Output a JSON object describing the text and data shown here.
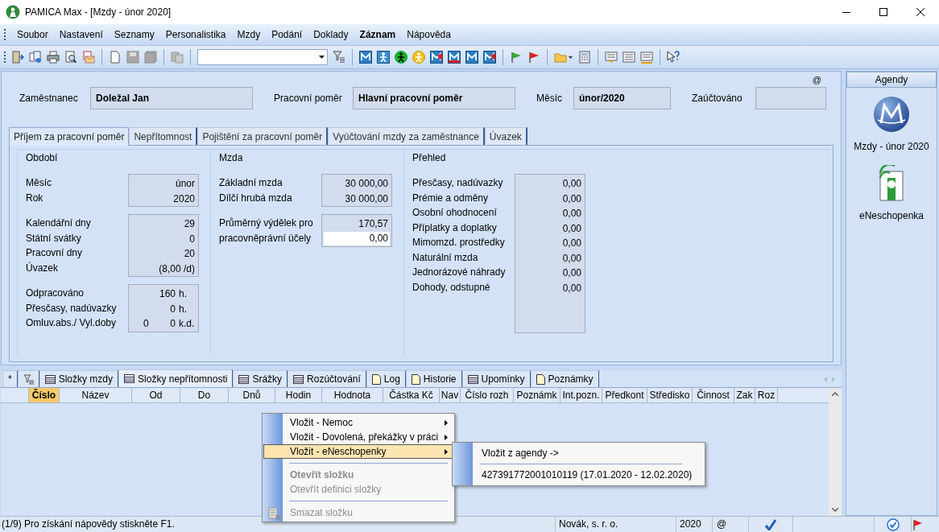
{
  "window": {
    "title": "PAMICA Max - [Mzdy - únor 2020]"
  },
  "menu": [
    {
      "label": "Soubor",
      "bold": false
    },
    {
      "label": "Nastavení",
      "bold": false
    },
    {
      "label": "Seznamy",
      "bold": false
    },
    {
      "label": "Personalistika",
      "bold": false
    },
    {
      "label": "Mzdy",
      "bold": false
    },
    {
      "label": "Podání",
      "bold": false
    },
    {
      "label": "Doklady",
      "bold": false
    },
    {
      "label": "Záznam",
      "bold": true
    },
    {
      "label": "Nápověda",
      "bold": false
    }
  ],
  "header": {
    "marker": "@",
    "fields": [
      {
        "label": "Zaměstnanec",
        "value": "Doležal Jan"
      },
      {
        "label": "Pracovní poměr",
        "value": "Hlavní pracovní poměr"
      },
      {
        "label": "Měsíc",
        "value": "únor/2020"
      },
      {
        "label": "Zaúčtováno"
      }
    ]
  },
  "tabs": [
    {
      "label": "Příjem za pracovní poměr",
      "selected": true
    },
    {
      "label": "Nepřítomnost",
      "selected": false
    },
    {
      "label": "Pojištění za pracovní poměr",
      "selected": false
    },
    {
      "label": "Vyúčtování mzdy za zaměstnance",
      "selected": false
    },
    {
      "label": "Úvazek",
      "selected": false
    }
  ],
  "groups": [
    {
      "title": "Období",
      "boxes": [
        {
          "rows": [
            {
              "label": "Měsíc",
              "values": [
                "únor"
              ]
            },
            {
              "label": "Rok",
              "values": [
                "2020"
              ]
            }
          ]
        },
        {
          "rows": [
            {
              "label": "Kalendářní dny",
              "values": [
                "29"
              ]
            },
            {
              "label": "Státní svátky",
              "values": [
                "0"
              ]
            },
            {
              "label": "Pracovní dny",
              "values": [
                "20"
              ]
            },
            {
              "label": "Úvazek",
              "values": [
                "(8,00 /d)"
              ]
            }
          ]
        },
        {
          "rows": [
            {
              "label": "Odpracováno",
              "values": [
                "160"
              ],
              "unit": "h."
            },
            {
              "label": "Přesčasy, nadúvazky",
              "values": [
                "0"
              ],
              "unit": "h."
            },
            {
              "label": "Omluv.abs./ Vyl.doby",
              "values": [
                "0",
                "0"
              ],
              "unit": "k.d."
            }
          ]
        }
      ]
    },
    {
      "title": "Mzda",
      "boxes": [
        {
          "rows": [
            {
              "label": "Základní mzda",
              "values": [
                "30 000,00"
              ]
            },
            {
              "label": "Dílčí hrubá mzda",
              "values": [
                "30 000,00"
              ]
            }
          ]
        },
        {
          "rows": [
            {
              "label": "Průměrný výdělek pro",
              "values": [
                "170,57"
              ]
            },
            {
              "label": "pracovněprávní účely",
              "values": [
                "0,00"
              ],
              "editable": true
            }
          ]
        }
      ]
    },
    {
      "title": "Přehled",
      "boxes": [
        {
          "tall": true,
          "rows": [
            {
              "label": "Přesčasy, nadúvazky",
              "values": [
                "0,00"
              ]
            },
            {
              "label": "Prémie a odměny",
              "values": [
                "0,00"
              ]
            },
            {
              "label": "Osobní ohodnocení",
              "values": [
                "0,00"
              ]
            },
            {
              "label": "Příplatky a doplatky",
              "values": [
                "0,00"
              ]
            },
            {
              "label": "Mimomzd. prostředky",
              "values": [
                "0,00"
              ]
            },
            {
              "label": "Naturální mzda",
              "values": [
                "0,00"
              ]
            },
            {
              "label": "Jednorázové náhrady",
              "values": [
                "0,00"
              ]
            },
            {
              "label": "Dohody, odstupné",
              "values": [
                "0,00"
              ]
            }
          ]
        }
      ]
    }
  ],
  "bottom_tabs": [
    {
      "kind": "text",
      "label": "*",
      "selected": false
    },
    {
      "kind": "filter",
      "selected": false
    },
    {
      "kind": "grid",
      "label": "Složky mzdy",
      "selected": false
    },
    {
      "kind": "grid",
      "label": "Složky nepřítomnosti",
      "selected": true
    },
    {
      "kind": "grid",
      "label": "Srážky",
      "selected": false
    },
    {
      "kind": "grid",
      "label": "Rozúčtování",
      "selected": false
    },
    {
      "kind": "doc",
      "label": "Log",
      "selected": false
    },
    {
      "kind": "doc",
      "label": "Historie",
      "selected": false
    },
    {
      "kind": "grid",
      "label": "Upomínky",
      "selected": false
    },
    {
      "kind": "doc",
      "label": "Poznámky",
      "selected": false
    }
  ],
  "columns": [
    {
      "label": "Číslo",
      "selected": true
    },
    {
      "label": "Název",
      "selected": false
    },
    {
      "label": "Od",
      "selected": false
    },
    {
      "label": "Do",
      "selected": false
    },
    {
      "label": "Dnů",
      "selected": false
    },
    {
      "label": "Hodin",
      "selected": false
    },
    {
      "label": "Hodnota",
      "selected": false
    },
    {
      "label": "Částka Kč",
      "selected": false
    },
    {
      "label": "Nav",
      "selected": false
    },
    {
      "label": "Číslo rozh",
      "selected": false
    },
    {
      "label": "Poznámk",
      "selected": false
    },
    {
      "label": "Int.pozn.",
      "selected": false
    },
    {
      "label": "Předkont",
      "selected": false
    },
    {
      "label": "Středisko",
      "selected": false
    },
    {
      "label": "Činnost",
      "selected": false
    },
    {
      "label": "Zak",
      "selected": false
    },
    {
      "label": "Roz",
      "selected": false
    }
  ],
  "context_menu": {
    "items": [
      {
        "kind": "item",
        "label": "Vložit - Nemoc",
        "submenu": true,
        "selected": false,
        "disabled": false,
        "bold": false,
        "glyph": false
      },
      {
        "kind": "item",
        "label": "Vložit - Dovolená, překážky v práci",
        "submenu": true,
        "selected": false,
        "disabled": false,
        "bold": false
      },
      {
        "kind": "item",
        "label": "Vložit - eNeschopenky",
        "submenu": true,
        "selected": true,
        "disabled": false,
        "bold": false
      },
      {
        "kind": "separator"
      },
      {
        "kind": "item",
        "label": "Otevřít složku",
        "submenu": false,
        "selected": false,
        "disabled": true,
        "bold": true
      },
      {
        "kind": "item",
        "label": "Otevřít definici složky",
        "submenu": false,
        "selected": false,
        "disabled": true,
        "bold": false
      },
      {
        "kind": "separator"
      },
      {
        "kind": "item",
        "label": "Smazat složku",
        "submenu": false,
        "selected": false,
        "disabled": true,
        "bold": false,
        "glyph": true
      }
    ]
  },
  "submenu": {
    "items": [
      {
        "kind": "item",
        "label": "Vložit z agendy ->"
      },
      {
        "kind": "separator"
      },
      {
        "kind": "item",
        "label": "427391772001010119 (17.01.2020 - 12.02.2020)"
      }
    ]
  },
  "agendy": {
    "title": "Agendy",
    "items": [
      {
        "kind": "m-logo",
        "label": "Mzdy - únor 2020"
      },
      {
        "kind": "eneschopenka",
        "label": "eNeschopenka"
      }
    ]
  },
  "status_bar": {
    "message": "(1/9) Pro získání nápovědy stiskněte F1.",
    "company": "Novák, s. r. o.",
    "year": "2020",
    "marker": "@"
  }
}
